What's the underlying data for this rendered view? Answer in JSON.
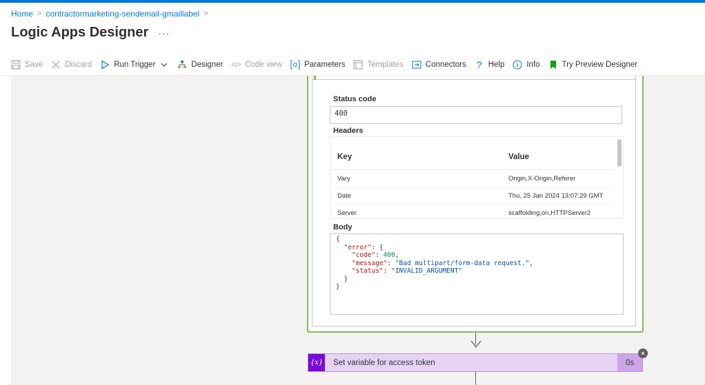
{
  "breadcrumb": {
    "home": "Home",
    "app": "contractormarketing-sendemail-gmaillabel"
  },
  "page": {
    "title": "Logic Apps Designer",
    "more": "···"
  },
  "toolbar": {
    "save": "Save",
    "discard": "Discard",
    "run_trigger": "Run Trigger",
    "designer": "Designer",
    "code_view": "Code view",
    "parameters": "Parameters",
    "templates": "Templates",
    "connectors": "Connectors",
    "help": "Help",
    "info": "Info",
    "try_preview": "Try Preview Designer"
  },
  "output": {
    "status_label": "Status code",
    "status_value": "400",
    "headers_label": "Headers",
    "headers_cols": {
      "key": "Key",
      "value": "Value"
    },
    "headers": [
      {
        "key": "Vary",
        "value": "Origin,X-Origin,Referer"
      },
      {
        "key": "Date",
        "value": "Thu, 25 Jan 2024 13:07:29 GMT"
      },
      {
        "key": "Server",
        "value": "scaffolding,on,HTTPServer2"
      }
    ],
    "body_label": "Body",
    "body": {
      "error_key": "\"error\"",
      "code_key": "\"code\"",
      "code_val": "400",
      "message_key": "\"message\"",
      "message_val": "\"Bad multipart/form-data request.\"",
      "status_key": "\"status\"",
      "status_val": "\"INVALID_ARGUMENT\""
    }
  },
  "next_step": {
    "icon": "{x}",
    "title": "Set variable for access token",
    "duration": "0s",
    "close": "×"
  },
  "colors": {
    "accent": "#0078d4",
    "success_border": "#7fba5c",
    "variable_purple": "#770bd6",
    "variable_bg": "#e6d3f3"
  }
}
